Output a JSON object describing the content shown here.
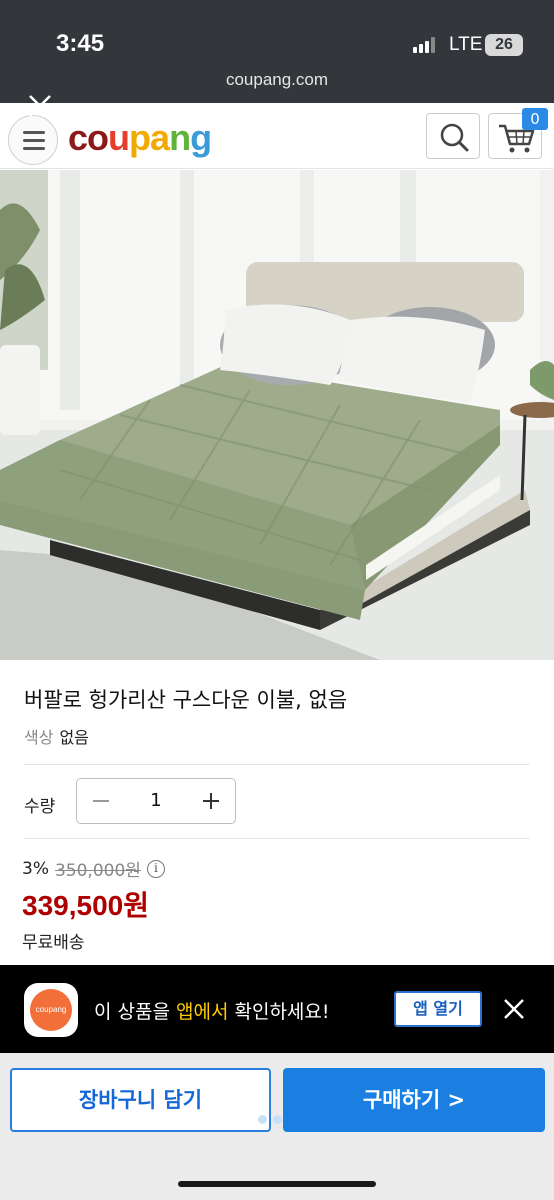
{
  "status_bar": {
    "time": "3:45",
    "network": "LTE",
    "battery": "26"
  },
  "browser": {
    "url": "coupang.com"
  },
  "header": {
    "logo_letters": [
      {
        "char": "c",
        "color": "#8b1a1a"
      },
      {
        "char": "o",
        "color": "#8b1a1a"
      },
      {
        "char": "u",
        "color": "#e53e2d"
      },
      {
        "char": "p",
        "color": "#f2a900"
      },
      {
        "char": "a",
        "color": "#f2a900"
      },
      {
        "char": "n",
        "color": "#5fb336"
      },
      {
        "char": "g",
        "color": "#3b9ad9"
      }
    ],
    "cart_count": "0"
  },
  "product": {
    "title": "버팔로 헝가리산 구스다운 이불, 없음",
    "option_label": "색상",
    "option_value": "없음",
    "quantity_label": "수량",
    "quantity": "1",
    "discount_rate": "3%",
    "original_price": "350,000원",
    "price": "339,500원",
    "shipping": "무료배송"
  },
  "app_banner": {
    "icon_text": "coupang",
    "text_before": "이 상품을 ",
    "text_highlight": "앱에서",
    "text_after": " 확인하세요!",
    "open_button": "앱 열기"
  },
  "actions": {
    "add_to_cart": "장바구니 담기",
    "buy_now": "구매하기 >"
  },
  "colors": {
    "price_red": "#ae0000",
    "accent_blue": "#1a7fe0",
    "highlight_yellow": "#ffcc00"
  }
}
